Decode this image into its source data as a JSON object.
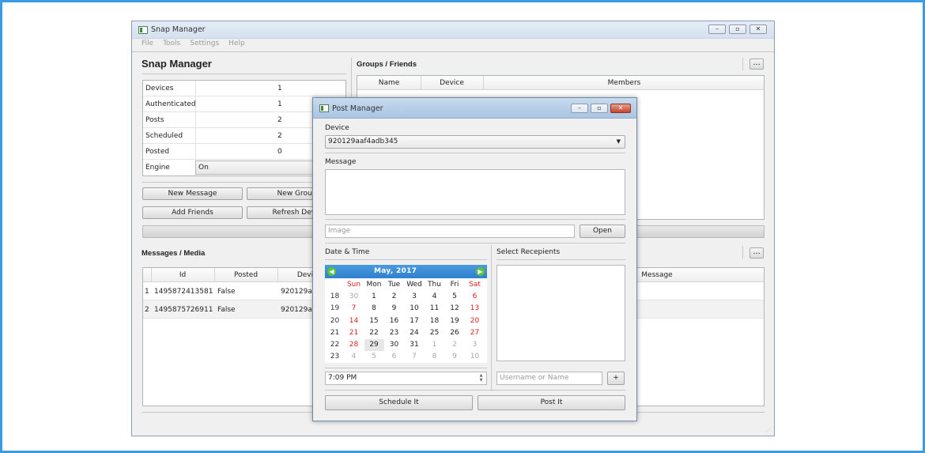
{
  "main": {
    "window_title": "Snap Manager",
    "menu": [
      "File",
      "Tools",
      "Settings",
      "Help"
    ],
    "heading": "Snap Manager",
    "stats": [
      {
        "label": "Devices",
        "value": "1"
      },
      {
        "label": "Authenticated",
        "value": "1"
      },
      {
        "label": "Posts",
        "value": "2"
      },
      {
        "label": "Scheduled",
        "value": "2"
      },
      {
        "label": "Posted",
        "value": "0"
      }
    ],
    "engine_label": "Engine",
    "engine_value": "On",
    "buttons": {
      "new_message": "New Message",
      "new_group": "New Group",
      "add_friends": "Add Friends",
      "refresh_devices": "Refresh Devic"
    },
    "groups": {
      "heading": "Groups / Friends",
      "more_button": "...",
      "columns": [
        "Name",
        "Device",
        "Members"
      ]
    },
    "messages": {
      "heading": "Messages / Media",
      "more_button": "...",
      "columns": [
        "Id",
        "Posted",
        "Devi",
        "Message"
      ],
      "rows": [
        {
          "num": "1",
          "id": "1495872413581",
          "posted": "False",
          "device": "920129aaf"
        },
        {
          "num": "2",
          "id": "1495875726911",
          "posted": "False",
          "device": "920129aaf"
        }
      ]
    }
  },
  "dialog": {
    "title": "Post Manager",
    "device_label": "Device",
    "device_value": "920129aaf4adb345",
    "message_label": "Message",
    "image_placeholder": "Image",
    "open_button": "Open",
    "datetime_label": "Date & Time",
    "recipients_label": "Select Recepients",
    "calendar": {
      "title": "May,  2017",
      "dow": [
        "Sun",
        "Mon",
        "Tue",
        "Wed",
        "Thu",
        "Fri",
        "Sat"
      ],
      "weeks": [
        {
          "wk": "18",
          "days": [
            "30",
            "1",
            "2",
            "3",
            "4",
            "5",
            "6"
          ]
        },
        {
          "wk": "19",
          "days": [
            "7",
            "8",
            "9",
            "10",
            "11",
            "12",
            "13"
          ]
        },
        {
          "wk": "20",
          "days": [
            "14",
            "15",
            "16",
            "17",
            "18",
            "19",
            "20"
          ]
        },
        {
          "wk": "21",
          "days": [
            "21",
            "22",
            "23",
            "24",
            "25",
            "26",
            "27"
          ]
        },
        {
          "wk": "22",
          "days": [
            "28",
            "29",
            "30",
            "31",
            "1",
            "2",
            "3"
          ]
        },
        {
          "wk": "23",
          "days": [
            "4",
            "5",
            "6",
            "7",
            "8",
            "9",
            "10"
          ]
        }
      ],
      "selected": "29"
    },
    "time_value": "7:09 PM",
    "username_placeholder": "Username or Name",
    "add_button": "+",
    "schedule_button": "Schedule It",
    "post_button": "Post It"
  },
  "colors": {
    "accent": "#3a9be0",
    "calendar_header": "#2f80cf",
    "weekend": "#e02020",
    "nav_arrow": "#5bc43a"
  }
}
